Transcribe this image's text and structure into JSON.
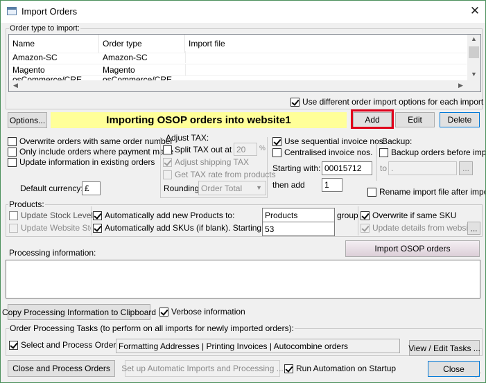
{
  "window": {
    "title": "Import Orders",
    "close_glyph": "✕"
  },
  "order_type": {
    "group_label": "Order type to import:",
    "columns": [
      "Name",
      "Order type",
      "Import file"
    ],
    "rows": [
      [
        "Amazon-SC",
        "Amazon-SC",
        ""
      ],
      [
        "Magento",
        "Magento",
        ""
      ],
      [
        "osCommerce/CRE",
        "osCommerce/CRE",
        ""
      ]
    ],
    "use_different_options": "Use different order import options for each import type"
  },
  "toolbar": {
    "options": "Options...",
    "banner": "Importing OSOP orders into website1",
    "add": "Add",
    "edit": "Edit",
    "delete": "Delete"
  },
  "left_options": {
    "overwrite": "Overwrite orders with same order number",
    "only_paid": "Only include orders where payment made",
    "update_existing": "Update information in existing orders",
    "default_currency_label": "Default currency:",
    "default_currency_value": "£"
  },
  "adjust_tax": {
    "group_label": "Adjust TAX:",
    "split_tax": "Split TAX out at",
    "split_value": "20",
    "percent": "%",
    "adjust_shipping": "Adjust shipping TAX",
    "get_rate": "Get TAX rate from products",
    "rounding_label": "Rounding:",
    "rounding_value": "Order Total"
  },
  "invoice": {
    "sequential": "Use sequential invoice nos.",
    "centralised": "Centralised invoice nos.",
    "starting_label": "Starting with:",
    "starting_value": "00015712",
    "then_add_label": "then add",
    "then_add_value": "1"
  },
  "backup": {
    "group_label": "Backup:",
    "backup_before": "Backup orders before import",
    "to_label": "to",
    "to_value": ".",
    "browse": "...",
    "rename": "Rename import file after import"
  },
  "products": {
    "group_label": "Products:",
    "update_stock": "Update Stock Levels",
    "update_website": "Update Website Stock",
    "auto_add_products": "Automatically add new Products to:",
    "products_value": "Products",
    "group_suffix": "group",
    "auto_add_skus": "Automatically add SKUs (if blank). Starting with:",
    "skus_value": "53",
    "overwrite_sku": "Overwrite if same SKU",
    "update_details": "Update details from website",
    "details_browse": "..."
  },
  "processing": {
    "label": "Processing information:",
    "import_button": "Import OSOP orders",
    "copy_button": "Copy Processing Information to Clipboard",
    "verbose": "Verbose information"
  },
  "tasks": {
    "group_label": "Order Processing Tasks (to perform on all imports for newly imported orders):",
    "select_process": "Select and Process Orders",
    "tasks_value": "Formatting Addresses | Printing Invoices | Autocombine orders",
    "view_edit": "View / Edit Tasks ..."
  },
  "footer": {
    "close_process": "Close and Process Orders",
    "setup_auto": "Set up Automatic Imports and Processing ...",
    "run_automation": "Run Automation on Startup",
    "close": "Close"
  }
}
